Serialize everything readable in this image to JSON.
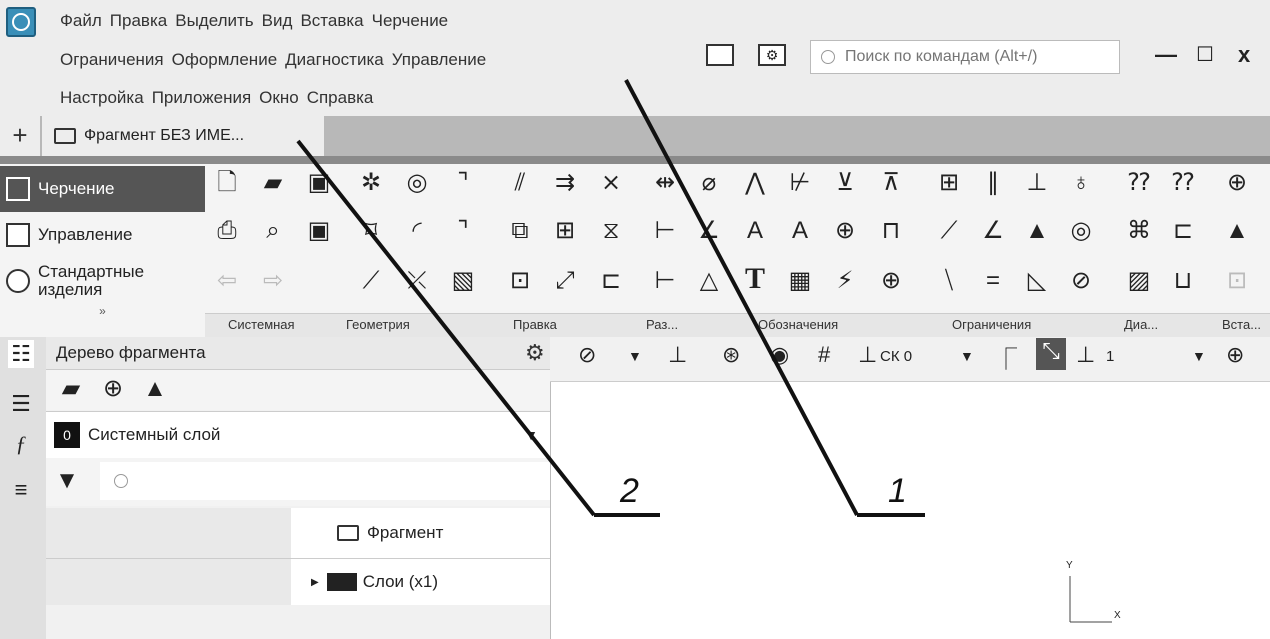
{
  "menu": {
    "row1": [
      "Файл",
      "Правка",
      "Выделить",
      "Вид",
      "Вставка",
      "Черчение"
    ],
    "row2": [
      "Ограничения",
      "Оформление",
      "Диагностика",
      "Управление"
    ],
    "row3": [
      "Настройка",
      "Приложения",
      "Окно",
      "Справка"
    ]
  },
  "search": {
    "placeholder": "Поиск по командам (Alt+/)"
  },
  "window_buttons": {
    "minimize": "—",
    "maximize": "☐",
    "close": "x"
  },
  "tabs": {
    "add": "+",
    "document": "Фрагмент БЕЗ ИМЕ..."
  },
  "ribbon": {
    "items": [
      "Черчение",
      "Управление",
      "Стандартные изделия"
    ],
    "chevron": "»",
    "groups": [
      "Системная",
      "Геометрия",
      "Правка",
      "Раз...",
      "Обозначения",
      "Ограничения",
      "Диа...",
      "Вста..."
    ]
  },
  "tree": {
    "title": "Дерево фрагмента",
    "layer_number": "0",
    "layer_name": "Системный слой",
    "node_fragment": "Фрагмент",
    "node_layers": "Слои (x1)"
  },
  "view_toolbar": {
    "cs": "СК 0",
    "step": "1"
  },
  "canvas": {
    "axis_x": "X",
    "axis_y": "Y"
  },
  "callouts": {
    "one": "1",
    "two": "2"
  }
}
